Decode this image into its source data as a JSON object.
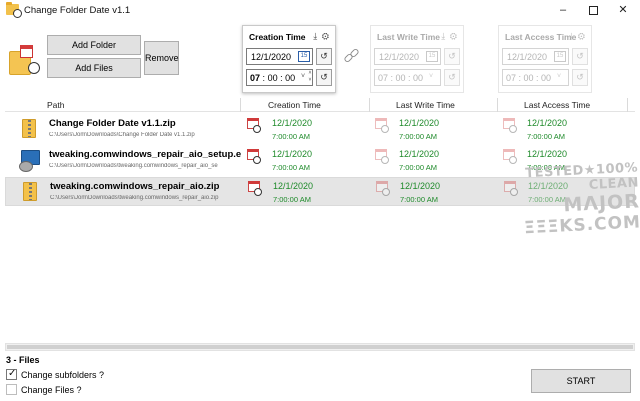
{
  "window": {
    "title": "Change Folder Date v1.1",
    "controls": {
      "minimize": "–",
      "maximize": "",
      "close": "✕"
    }
  },
  "toolbar": {
    "add_folder_label": "Add Folder",
    "add_files_label": "Add Files",
    "remove_label": "Remove"
  },
  "panels": {
    "creation": {
      "title": "Creation Time",
      "date": "12/1/2020",
      "hour": "07",
      "minute": "00",
      "second": "00",
      "enabled": true
    },
    "last_write": {
      "title": "Last Write Time",
      "date": "12/1/2020",
      "time": "07 : 00 : 00",
      "enabled": false
    },
    "last_access": {
      "title": "Last Access Time",
      "date": "12/1/2020",
      "time": "07 : 00 : 00",
      "enabled": false
    },
    "tools": "⤓ ⚙",
    "undo": "↺",
    "cal_mini": "15",
    "dd": "˅",
    "spin_up": "˄",
    "spin_down": "˅",
    "time_sep": ":"
  },
  "grid": {
    "headers": {
      "path": "Path",
      "creation": "Creation Time",
      "last_write": "Last Write Time",
      "last_access": "Last Access Time"
    },
    "rows": [
      {
        "name": "Change Folder Date v1.1.zip",
        "path": "C:\\Users\\Jom\\Downloads\\Change Folder Date v1.1.zip",
        "icon": "zip-icon",
        "creation": {
          "date": "12/1/2020",
          "time": "7:00:00 AM"
        },
        "last_write": {
          "date": "12/1/2020",
          "time": "7:00:00 AM"
        },
        "last_access": {
          "date": "12/1/2020",
          "time": "7:00:00 AM"
        }
      },
      {
        "name": "tweaking.comwindows_repair_aio_setup.e",
        "path": "C:\\Users\\Jom\\Downloads\\tweaking.comwindows_repair_aio_se",
        "icon": "installer-icon",
        "creation": {
          "date": "12/1/2020",
          "time": "7:00:00 AM"
        },
        "last_write": {
          "date": "12/1/2020",
          "time": "7:00:00 AM"
        },
        "last_access": {
          "date": "12/1/2020",
          "time": "7:00:00 AM"
        }
      },
      {
        "name": "tweaking.comwindows_repair_aio.zip",
        "path": "C:\\Users\\Jom\\Downloads\\tweaking.comwindows_repair_aio.zip",
        "icon": "zip-icon",
        "creation": {
          "date": "12/1/2020",
          "time": "7:00:00 AM"
        },
        "last_write": {
          "date": "12/1/2020",
          "time": "7:00:00 AM"
        },
        "last_access": {
          "date": "12/1/2020",
          "time": "7:00:00 AM"
        }
      }
    ]
  },
  "watermark": {
    "line1": "TESTED★100% CLEAN",
    "line2": "ΜΛJOR",
    "line3": "ΞΞΞKS.COM"
  },
  "footer": {
    "status": "3 - Files",
    "change_subfolders_label": "Change subfolders ?",
    "change_subfolders_checked": true,
    "change_files_label": "Change Files ?",
    "change_files_checked": false,
    "start_label": "START"
  },
  "colors": {
    "date_green": "#1e8a2a",
    "calendar_red": "#d03a3a"
  }
}
